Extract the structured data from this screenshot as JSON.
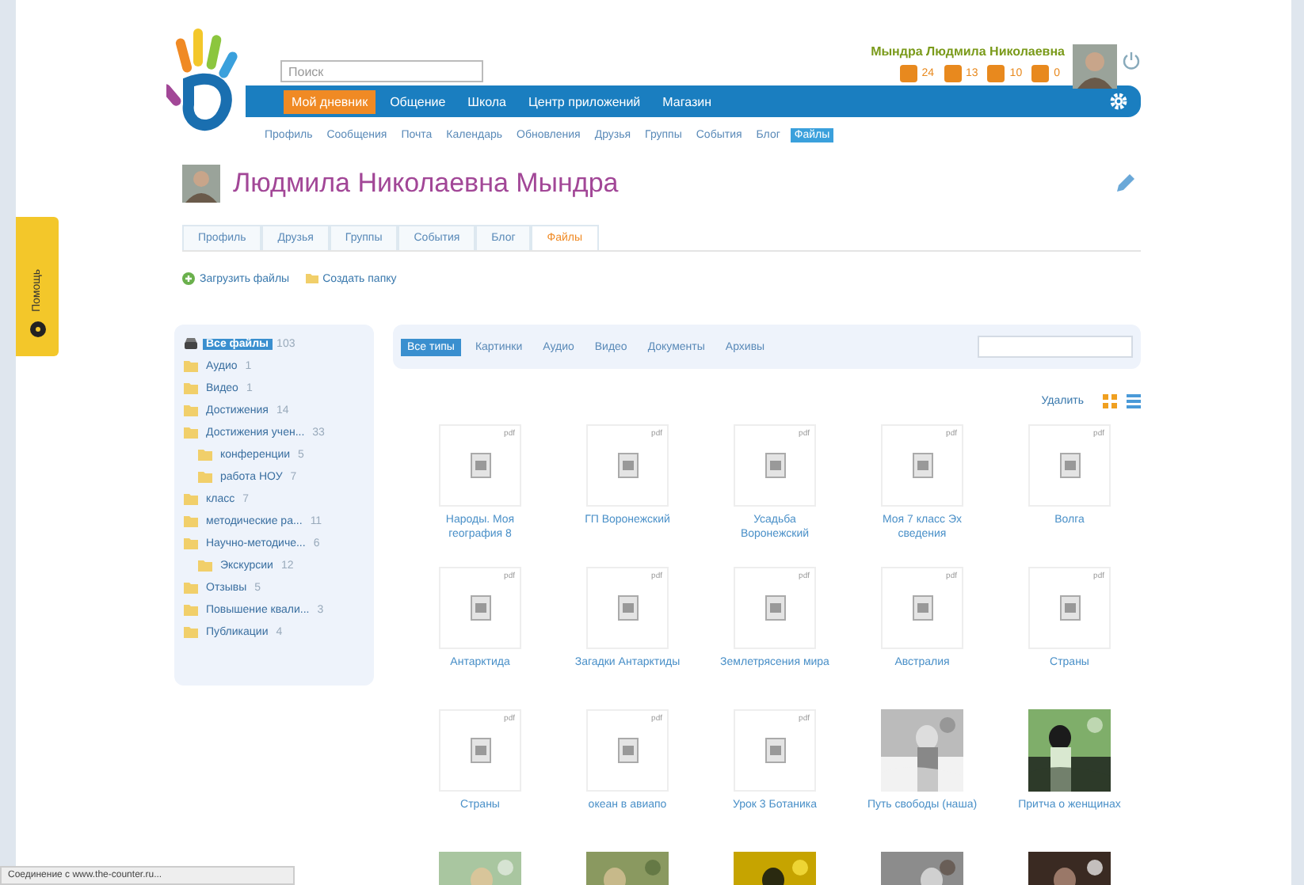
{
  "header": {
    "search": {
      "placeholder": "Поиск"
    },
    "user_name": "Мындра Людмила Николаевна",
    "counters": [
      {
        "value": "24"
      },
      {
        "value": "13"
      },
      {
        "value": "10"
      },
      {
        "value": "0"
      }
    ]
  },
  "nav": [
    {
      "label": "Мой дневник",
      "selected": true
    },
    {
      "label": "Общение",
      "selected": false
    },
    {
      "label": "Школа",
      "selected": false
    },
    {
      "label": "Центр приложений",
      "selected": false
    },
    {
      "label": "Магазин",
      "selected": false
    }
  ],
  "subnav": [
    {
      "label": "Профиль",
      "selected": false
    },
    {
      "label": "Сообщения",
      "selected": false
    },
    {
      "label": "Почта",
      "selected": false
    },
    {
      "label": "Календарь",
      "selected": false
    },
    {
      "label": "Обновления",
      "selected": false
    },
    {
      "label": "Друзья",
      "selected": false
    },
    {
      "label": "Группы",
      "selected": false
    },
    {
      "label": "События",
      "selected": false
    },
    {
      "label": "Блог",
      "selected": false
    },
    {
      "label": "Файлы",
      "selected": true
    }
  ],
  "profile": {
    "name": "Людмила Николаевна Мындра"
  },
  "tabs": [
    {
      "label": "Профиль",
      "selected": false
    },
    {
      "label": "Друзья",
      "selected": false
    },
    {
      "label": "Группы",
      "selected": false
    },
    {
      "label": "События",
      "selected": false
    },
    {
      "label": "Блог",
      "selected": false
    },
    {
      "label": "Файлы",
      "selected": true
    }
  ],
  "actions": [
    {
      "kind": "upload",
      "label": "Загрузить файлы"
    },
    {
      "kind": "folder",
      "label": "Создать папку"
    }
  ],
  "tree": [
    {
      "kind": "root",
      "label": "Все файлы",
      "count": "103",
      "selected": true
    },
    {
      "kind": "folder",
      "label": "Аудио",
      "count": "1",
      "selected": false
    },
    {
      "kind": "folder",
      "label": "Видео",
      "count": "1",
      "selected": false
    },
    {
      "kind": "folder",
      "label": "Достижения",
      "count": "14",
      "selected": false
    },
    {
      "kind": "folder",
      "label": "Достижения учен...",
      "count": "33",
      "selected": false,
      "children": [
        {
          "kind": "folder",
          "label": "конференции",
          "count": "5",
          "selected": false
        },
        {
          "kind": "folder",
          "label": "работа НОУ",
          "count": "7",
          "selected": false
        }
      ]
    },
    {
      "kind": "folder",
      "label": "класс",
      "count": "7",
      "selected": false
    },
    {
      "kind": "folder",
      "label": "методические ра...",
      "count": "11",
      "selected": false
    },
    {
      "kind": "folder",
      "label": "Научно-методиче...",
      "count": "6",
      "selected": false,
      "children": [
        {
          "kind": "folder",
          "label": "Экскурсии",
          "count": "12",
          "selected": false
        }
      ]
    },
    {
      "kind": "folder",
      "label": "Отзывы",
      "count": "5",
      "selected": false
    },
    {
      "kind": "folder",
      "label": "Повышение квали...",
      "count": "3",
      "selected": false
    },
    {
      "kind": "folder",
      "label": "Публикации",
      "count": "4",
      "selected": false
    }
  ],
  "filters": [
    {
      "label": "Все типы",
      "selected": true
    },
    {
      "label": "Картинки",
      "selected": false
    },
    {
      "label": "Аудио",
      "selected": false
    },
    {
      "label": "Видео",
      "selected": false
    },
    {
      "label": "Документы",
      "selected": false
    },
    {
      "label": "Архивы",
      "selected": false
    }
  ],
  "delete_label": "Удалить",
  "views": [
    {
      "kind": "grid",
      "selected": true
    },
    {
      "kind": "list",
      "selected": false
    }
  ],
  "files": [
    {
      "kind": "document",
      "type": "pdf",
      "name": "Народы. Моя география 8"
    },
    {
      "kind": "document",
      "type": "pdf",
      "name": "ГП Воронежский"
    },
    {
      "kind": "document",
      "type": "pdf",
      "name": "Усадьба Воронежский"
    },
    {
      "kind": "document",
      "type": "pdf",
      "name": "Моя 7 класс Эх сведения"
    },
    {
      "kind": "document",
      "type": "pdf",
      "name": "Волга"
    },
    {
      "kind": "document",
      "type": "pdf",
      "name": "Антарктида"
    },
    {
      "kind": "document",
      "type": "pdf",
      "name": "Загадки Антарктиды"
    },
    {
      "kind": "document",
      "type": "pdf",
      "name": "Землетрясения мира"
    },
    {
      "kind": "document",
      "type": "pdf",
      "name": "Австралия"
    },
    {
      "kind": "document",
      "type": "pdf",
      "name": "Страны"
    },
    {
      "kind": "document",
      "type": "pdf",
      "name": "Страны"
    },
    {
      "kind": "document",
      "type": "pdf",
      "name": "океан в авиапо"
    },
    {
      "kind": "document",
      "type": "pdf",
      "name": "Урок 3 Ботаника"
    },
    {
      "kind": "picture",
      "name": "Путь свободы (наша)"
    },
    {
      "kind": "picture",
      "name": "Притча о женщинах"
    },
    {
      "kind": "picture"
    },
    {
      "kind": "picture"
    },
    {
      "kind": "picture"
    },
    {
      "kind": "picture"
    },
    {
      "kind": "picture"
    }
  ],
  "help_label": "Помощь",
  "status_bar": "Соединение с www.the-counter.ru..."
}
